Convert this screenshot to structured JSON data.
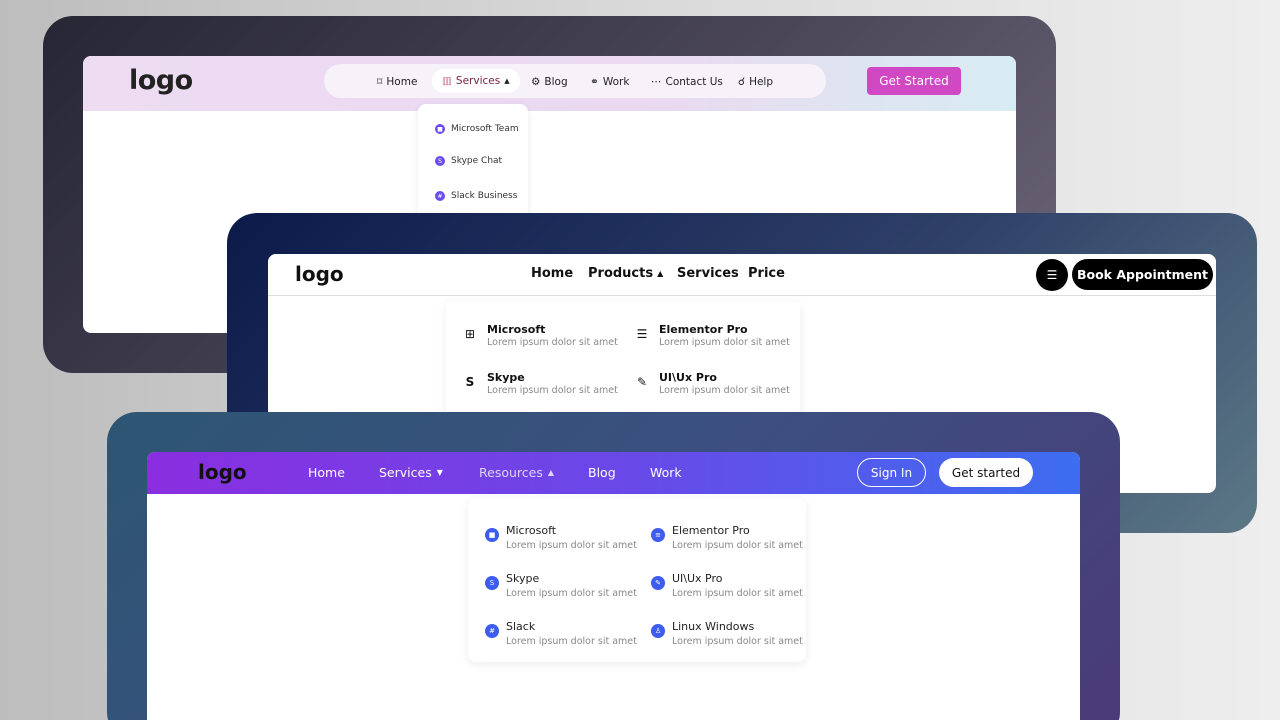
{
  "menu1": {
    "logo": "logo",
    "nav": [
      {
        "icon": "bookmark-icon",
        "glyph": "⌑",
        "label": "Home"
      },
      {
        "icon": "chart-icon",
        "glyph": "▥",
        "label": "Services",
        "caret": "▲"
      },
      {
        "icon": "gear-icon",
        "glyph": "⚙",
        "label": "Blog"
      },
      {
        "icon": "link-icon",
        "glyph": "⚭",
        "label": "Work"
      },
      {
        "icon": "chat-icon",
        "glyph": "⋯",
        "label": "Contact Us"
      },
      {
        "icon": "help-icon",
        "glyph": "☌",
        "label": "Help"
      }
    ],
    "cta": "Get Started",
    "dropdown": [
      "Microsoft Team",
      "Skype Chat",
      "Slack Business"
    ],
    "colors": {
      "accent": "#d048c4",
      "active_text": "#7a1e3a",
      "dot": "#6c4cf0"
    }
  },
  "menu2": {
    "logo": "logo",
    "nav": [
      "Home",
      "Products",
      "Services",
      "Price"
    ],
    "caret": "▲",
    "settings_icon": "sliders-icon",
    "cta": "Book Appointment",
    "dropdown": [
      {
        "icon": "windows-icon",
        "glyph": "⊞",
        "title": "Microsoft",
        "sub": "Lorem ipsum dolor sit amet"
      },
      {
        "icon": "elementor-icon",
        "glyph": "☰",
        "title": "Elementor Pro",
        "sub": "Lorem ipsum dolor sit amet"
      },
      {
        "icon": "skype-icon",
        "glyph": "S",
        "title": "Skype",
        "sub": "Lorem ipsum dolor sit amet"
      },
      {
        "icon": "brush-icon",
        "glyph": "✎",
        "title": "UI\\Ux Pro",
        "sub": "Lorem ipsum dolor sit amet"
      }
    ]
  },
  "menu3": {
    "logo": "logo",
    "nav": [
      {
        "label": "Home"
      },
      {
        "label": "Services",
        "caret": "▼"
      },
      {
        "label": "Resources",
        "caret": "▲"
      },
      {
        "label": "Blog"
      },
      {
        "label": "Work"
      }
    ],
    "signin": "Sign In",
    "cta": "Get started",
    "dropdown": [
      {
        "icon": "windows-icon",
        "glyph": "■",
        "title": "Microsoft",
        "sub": "Lorem ipsum dolor sit amet"
      },
      {
        "icon": "elementor-icon",
        "glyph": "≡",
        "title": "Elementor Pro",
        "sub": "Lorem ipsum dolor sit amet"
      },
      {
        "icon": "skype-icon",
        "glyph": "S",
        "title": "Skype",
        "sub": "Lorem ipsum dolor sit amet"
      },
      {
        "icon": "brush-icon",
        "glyph": "✎",
        "title": "UI\\Ux Pro",
        "sub": "Lorem ipsum dolor sit amet"
      },
      {
        "icon": "slack-icon",
        "glyph": "#",
        "title": "Slack",
        "sub": "Lorem ipsum dolor sit amet"
      },
      {
        "icon": "linux-icon",
        "glyph": "♙",
        "title": "Linux Windows",
        "sub": "Lorem ipsum dolor sit amet"
      }
    ],
    "colors": {
      "gradient_start": "#8a2ee0",
      "gradient_end": "#3d6df0",
      "icon_bg": "#3d5cf0"
    }
  }
}
